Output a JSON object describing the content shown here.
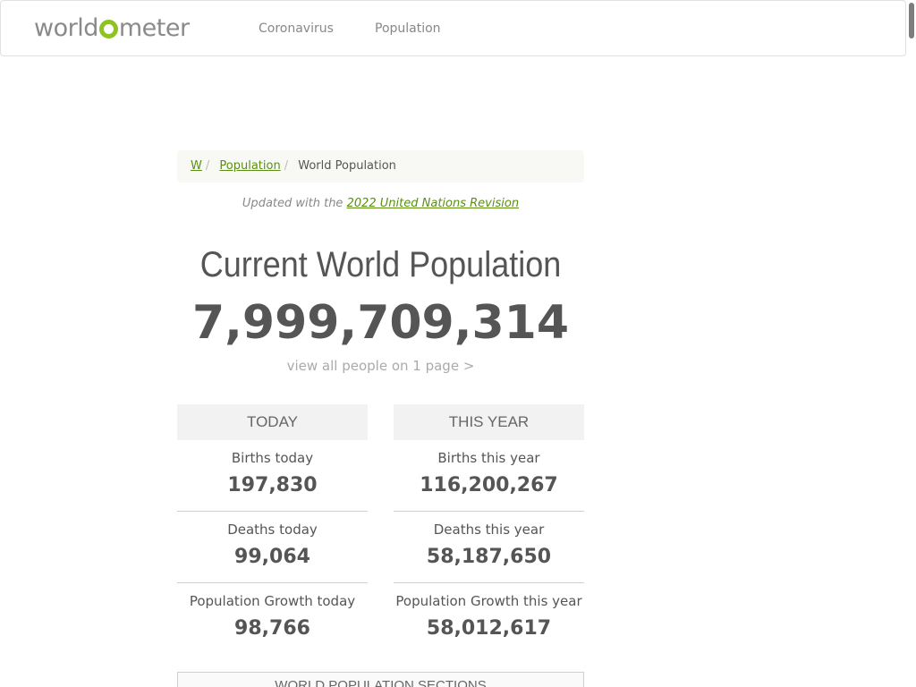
{
  "navbar": {
    "logo_pre": "world",
    "logo_post": "meter",
    "links": [
      "Coronavirus",
      "Population"
    ]
  },
  "breadcrumb": {
    "items": [
      "W",
      "Population",
      "World Population"
    ]
  },
  "updated": {
    "prefix": "Updated with the",
    "link": "2022 United Nations Revision"
  },
  "main": {
    "title": "Current World Population",
    "counter": "7,999,709,314",
    "view_all": "view all people on 1 page >"
  },
  "today": {
    "header": "TODAY",
    "stats": [
      {
        "label": "Births today",
        "value": "197,830"
      },
      {
        "label": "Deaths today",
        "value": "99,064"
      },
      {
        "label": "Population Growth today",
        "value": "98,766"
      }
    ]
  },
  "this_year": {
    "header": "THIS YEAR",
    "stats": [
      {
        "label": "Births this year",
        "value": "116,200,267"
      },
      {
        "label": "Deaths this year",
        "value": "58,187,650"
      },
      {
        "label": "Population Growth this year",
        "value": "58,012,617"
      }
    ]
  },
  "sections": {
    "title": "WORLD POPULATION SECTIONS"
  },
  "colors": {
    "accent": "#8fc31f",
    "link": "#5a8f14"
  }
}
